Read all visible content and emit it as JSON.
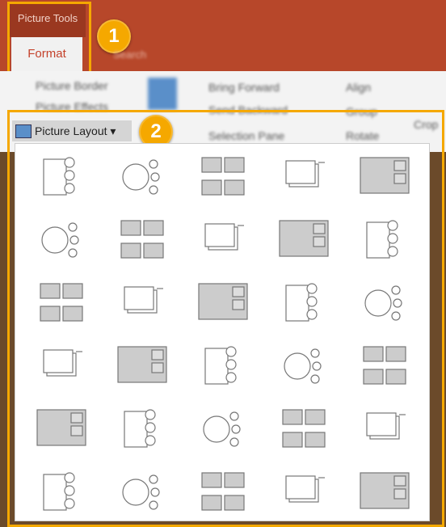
{
  "header": {
    "context_tab": "Picture Tools",
    "active_tab": "Format",
    "search": "Search"
  },
  "badges": [
    "1",
    "2"
  ],
  "ribbon": {
    "picture_border": "Picture Border",
    "picture_effects": "Picture Effects",
    "bring_forward": "Bring Forward",
    "send_backward": "Send Backward",
    "selection_pane": "Selection Pane",
    "align": "Align",
    "group": "Group",
    "rotate": "Rotate",
    "crop": "Crop"
  },
  "picture_layout": {
    "label": "Picture Layout ▾",
    "rows": 6,
    "columns": 5
  },
  "colors": {
    "accent": "#f5a800",
    "brand": "#b7472a"
  }
}
